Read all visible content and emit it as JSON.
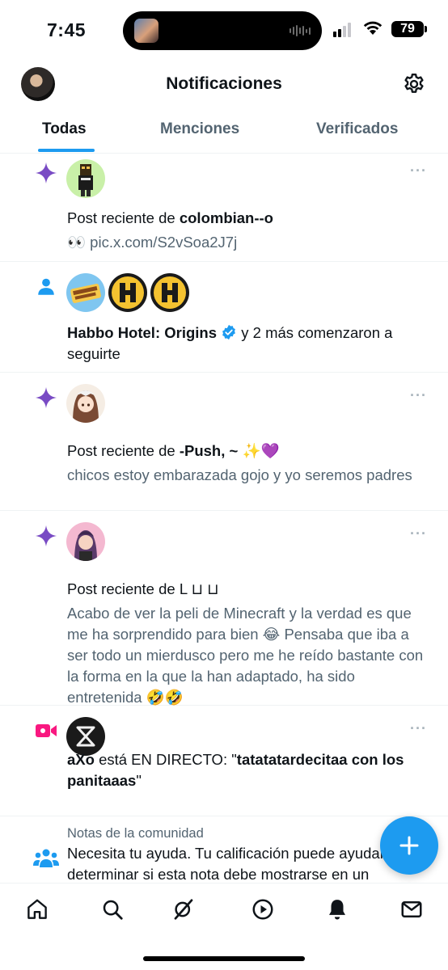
{
  "status_bar": {
    "time": "7:45",
    "battery": "79"
  },
  "header": {
    "title": "Notificaciones"
  },
  "tabs": [
    {
      "label": "Todas",
      "active": true
    },
    {
      "label": "Menciones",
      "active": false
    },
    {
      "label": "Verificados",
      "active": false
    }
  ],
  "notifications": [
    {
      "type": "post-reciente",
      "prefix": "Post reciente de ",
      "user": "colombian--o",
      "body": "👀 pic.x.com/S2vSoa2J7j"
    },
    {
      "type": "follow",
      "user": "Habbo Hotel: Origins",
      "suffix": " y 2 más comenzaron a seguirte"
    },
    {
      "type": "post-reciente",
      "prefix": "Post reciente de ",
      "user": "-Push, ~ ✨💜",
      "body": "chicos estoy embarazada gojo y yo seremos padres"
    },
    {
      "type": "post-reciente",
      "prefix": "Post reciente de L ⊔ ⊔",
      "body": "Acabo de ver la peli de Minecraft y la verdad es que me ha sorprendido para bien 😂 Pensaba que iba a ser todo un mierdusco pero me he reído bastante con la forma en la que la han adaptado, ha sido entretenida 🤣🤣"
    },
    {
      "type": "live",
      "user": "aXo",
      "middle": " está EN DIRECTO: \"",
      "stream_title": "tatatatardecitaa con los panitaaas",
      "end": "\""
    },
    {
      "type": "community-notes",
      "label": "Notas de la comunidad",
      "text": "Necesita tu ayuda. Tu calificación puede ayudar a determinar si esta nota debe mostrarse en un"
    }
  ],
  "more_glyph": "···",
  "colors": {
    "accent": "#1d9bf0",
    "sparkle": "#794bc4",
    "live": "#f91880",
    "secondary_text": "#536471"
  },
  "icons": {
    "nav": [
      "home-icon",
      "search-icon",
      "grok-icon",
      "video-icon",
      "notifications-bell-icon",
      "messages-icon"
    ]
  }
}
